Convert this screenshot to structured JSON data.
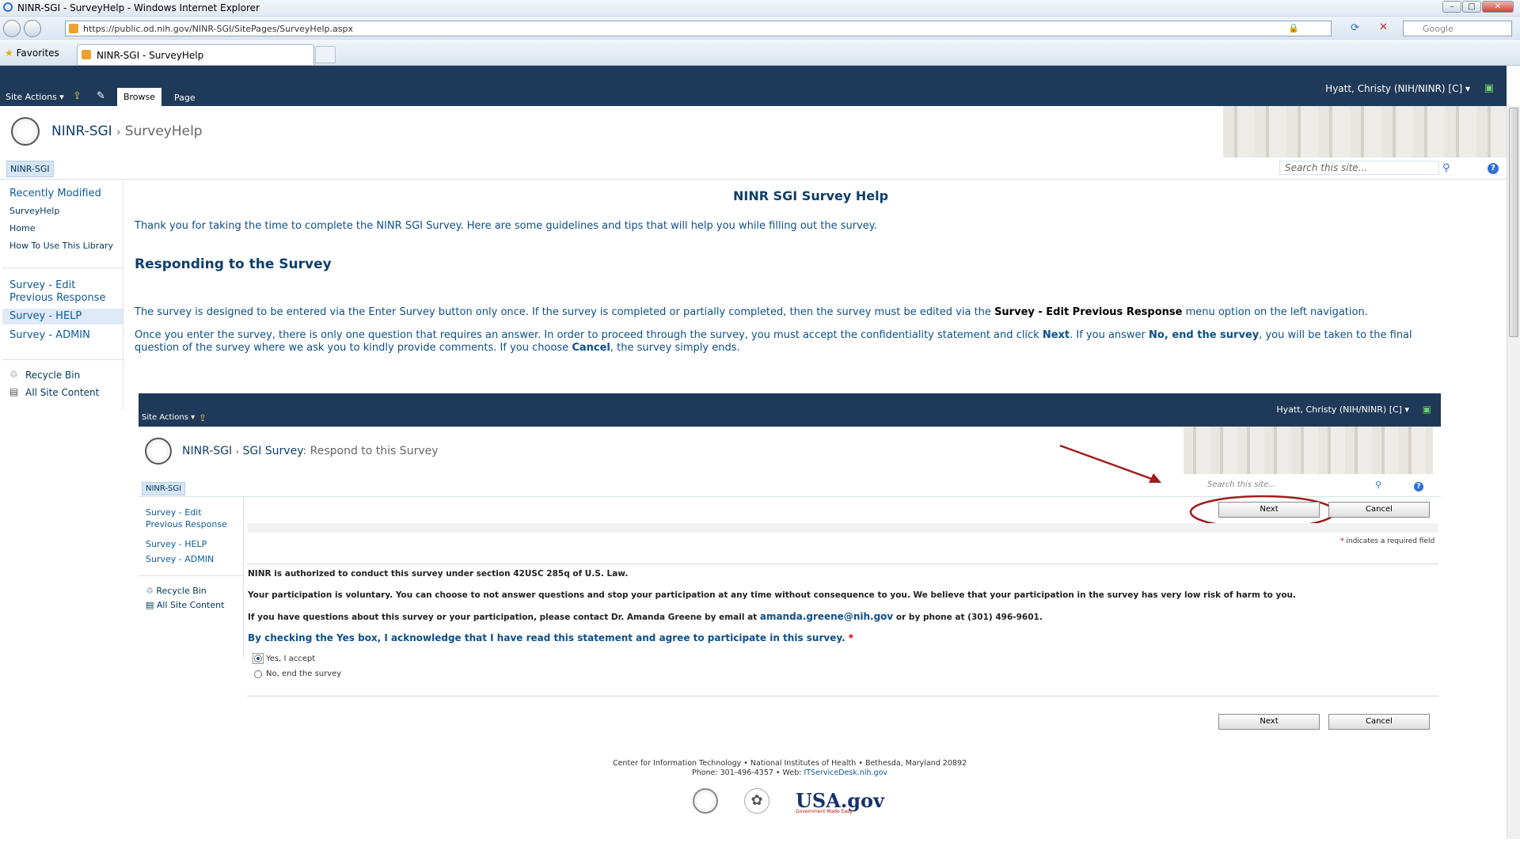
{
  "browser": {
    "window_title": "NINR-SGI - SurveyHelp - Windows Internet Explorer",
    "url": "https://public.od.nih.gov/NINR-SGI/SitePages/SurveyHelp.aspx",
    "search_placeholder": "Google",
    "favorites_label": "Favorites",
    "tab_title": "NINR-SGI - SurveyHelp"
  },
  "ribbon": {
    "site_actions": "Site Actions",
    "tab_browse": "Browse",
    "tab_page": "Page",
    "user": "Hyatt, Christy (NIH/NINR) [C]"
  },
  "header": {
    "site": "NINR-SGI",
    "separator": "›",
    "page": "SurveyHelp",
    "nav_tab": "NINR-SGI",
    "search_placeholder": "Search this site..."
  },
  "leftnav": {
    "recently_modified": "Recently Modified",
    "recent": [
      "SurveyHelp",
      "Home",
      "How To Use This Library"
    ],
    "survey_edit": "Survey - Edit Previous Response",
    "survey_help": "Survey - HELP",
    "survey_admin": "Survey - ADMIN",
    "recycle_bin": "Recycle Bin",
    "all_site_content": "All Site Content"
  },
  "content": {
    "title": "NINR SGI Survey Help",
    "intro": "Thank you for taking the time to complete the NINR SGI Survey. Here are some guidelines and tips that will help you while filling out the survey.",
    "heading": "Responding to the Survey",
    "p1_a": "The survey is designed to be entered via the Enter Survey button only once.  If the survey is completed or partially completed, then the survey must be edited via the ",
    "p1_b": "Survey - Edit Previous Response",
    "p1_c": " menu option on the left navigation.",
    "p2_a": "Once you enter the survey, there is only one question that requires an answer. In order to proceed through the survey, you must accept the confidentiality statement and click ",
    "p2_b": "Next",
    "p2_c": ". If you answer ",
    "p2_d": "No, end the survey",
    "p2_e": ", you will be taken to the final",
    "p2_f": "question of the survey where we ask you to kindly provide comments. If you choose ",
    "p2_g": "Cancel",
    "p2_h": ", the survey simply ends."
  },
  "screenshot": {
    "site_actions": "Site Actions",
    "user": "Hyatt, Christy (NIH/NINR) [C]",
    "site": "NINR-SGI",
    "separator": "›",
    "list": "SGI Survey",
    "page": ": Respond to this Survey",
    "nav_tab": "NINR-SGI",
    "search_placeholder": "Search this site...",
    "left": [
      "Survey - Edit",
      "Previous Response",
      "Survey - HELP",
      "Survey - ADMIN"
    ],
    "recycle_bin": "Recycle Bin",
    "all_site_content": "All Site Content",
    "next": "Next",
    "cancel": "Cancel",
    "required_mark": "*",
    "required_note": " indicates a required field",
    "auth": "NINR is authorized to conduct this survey under section 42USC 285q of U.S. Law.",
    "voluntary": "Your participation is voluntary. You can choose to not answer questions and stop your participation at any time without consequence to you. We believe that your participation in the survey has very low risk of harm to you.",
    "contact_a": "If you have questions about this survey or your participation, please contact Dr. Amanda Greene by email at ",
    "contact_email": "amanda.greene@nih.gov",
    "contact_b": " or by phone at (301) 496-9601.",
    "question": "By checking the Yes box, I acknowledge that I have read this statement and agree to participate in this survey.",
    "question_required": "*",
    "opt_yes": "Yes, I accept",
    "opt_no": "No, end the survey",
    "footer_line1": "Center for Information Technology • National Institutes of Health • Bethesda, Maryland 20892",
    "footer_line2a": "Phone: 301-496-4357 • Web: ",
    "footer_link": "ITServiceDesk.nih.gov",
    "usa_logo_text": "USA.gov",
    "usa_logo_sub": "Government Made Easy"
  }
}
